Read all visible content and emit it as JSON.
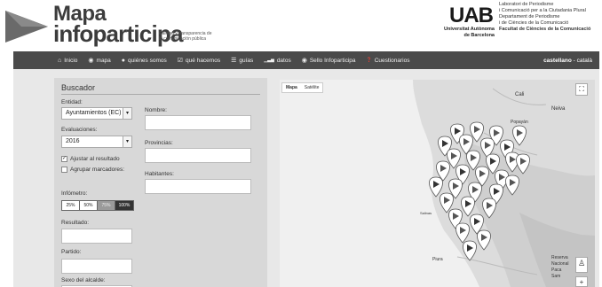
{
  "header": {
    "logo_line1": "Mapa",
    "logo_line2": "infoparticipa",
    "logo_tagline": "Calidad y transparencia de la comunicación pública",
    "uab_logo": "UAB",
    "uab_name_line1": "Universitat Autònoma",
    "uab_name_line2": "de Barcelona",
    "univ_lines": [
      "Laboratori de Periodisme",
      "i Comunicació per a la Ciutadania Plural",
      "Departament de Periodisme",
      "i de Ciències de la Comunicació",
      "Facultat de Ciències de la Comunicació"
    ]
  },
  "nav": {
    "items": [
      {
        "label": "Inicio",
        "icon": "home-icon",
        "glyph": "⌂"
      },
      {
        "label": "mapa",
        "icon": "map-pin-icon",
        "glyph": "◉"
      },
      {
        "label": "quiénes somos",
        "icon": "user-icon",
        "glyph": "●"
      },
      {
        "label": "qué hacemos",
        "icon": "check-square-icon",
        "glyph": "☑"
      },
      {
        "label": "guías",
        "icon": "list-icon",
        "glyph": "☰"
      },
      {
        "label": "datos",
        "icon": "bar-chart-icon",
        "glyph": "▁▃▅"
      },
      {
        "label": "Sello Infoparticipa",
        "icon": "map-marker-icon",
        "glyph": "◉"
      },
      {
        "label": "Cuestionarios",
        "icon": "question-icon",
        "glyph": "❓"
      }
    ],
    "lang_active": "castellano",
    "lang_sep": " - ",
    "lang_other": "català"
  },
  "search": {
    "title": "Buscador",
    "entity_label": "Entidad:",
    "entity_value": "Ayuntamientos (EC)",
    "evaluations_label": "Evaluaciones:",
    "evaluations_value": "2016",
    "adjust_label": "Ajustar al resultado",
    "adjust_checked": true,
    "group_label": "Agrupar marcadores:",
    "group_checked": false,
    "infometer_label": "Infómetro:",
    "infometer_options": [
      "25%",
      "50%",
      "75%",
      "100%"
    ],
    "result_label": "Resultado:",
    "party_label": "Partido:",
    "mayor_sex_label": "Sexo del alcalde:",
    "name_label": "Nombre:",
    "provinces_label": "Provincias:",
    "inhabitants_label": "Habitantes:"
  },
  "map": {
    "tab_map": "Mapa",
    "tab_satellite": "Satélite",
    "places": [
      "Cali",
      "Neiva",
      "Popayán",
      "Salinas",
      "Piura",
      "Reserva",
      "Nacional",
      "Paca",
      "Sam"
    ]
  }
}
